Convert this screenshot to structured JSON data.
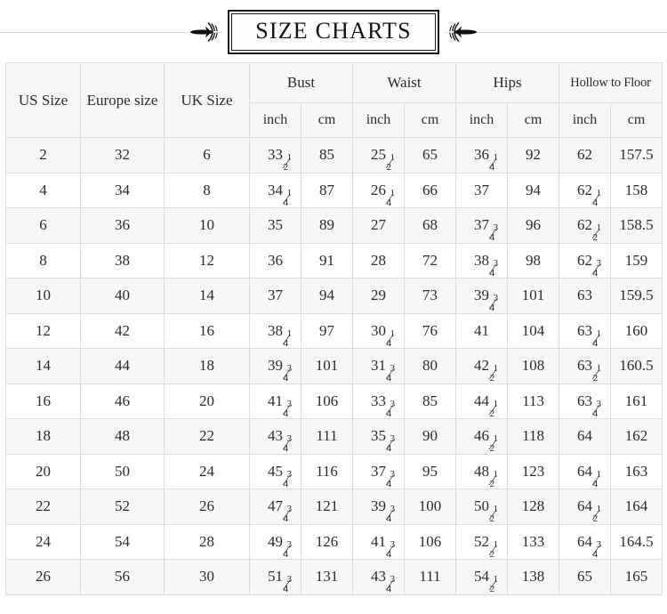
{
  "banner": {
    "title": "SIZE CHARTS",
    "left_ornament": "leaf-fleuron-icon",
    "right_ornament": "leaf-fleuron-icon"
  },
  "colors": {
    "header_bg": "#f7f7f7",
    "row_shade_bg": "#f7f7f7",
    "row_plain_bg": "#ffffff",
    "border": "#dcdcdc",
    "text": "#2b2b2b",
    "title_border": "#1a1a1a",
    "rule": "#d9d9d9"
  },
  "table": {
    "group_headers": [
      {
        "label": "US Size",
        "span": 1,
        "rowspan": 2
      },
      {
        "label": "Europe size",
        "span": 1,
        "rowspan": 2
      },
      {
        "label": "UK Size",
        "span": 1,
        "rowspan": 2
      },
      {
        "label": "Bust",
        "span": 2,
        "rowspan": 1
      },
      {
        "label": "Waist",
        "span": 2,
        "rowspan": 1
      },
      {
        "label": "Hips",
        "span": 2,
        "rowspan": 1
      },
      {
        "label": "Hollow to Floor",
        "span": 2,
        "rowspan": 1
      }
    ],
    "unit_headers": [
      "inch",
      "cm",
      "inch",
      "cm",
      "inch",
      "cm",
      "inch",
      "cm"
    ],
    "columns": [
      "US Size",
      "Europe size",
      "UK Size",
      "Bust inch",
      "Bust cm",
      "Waist inch",
      "Waist cm",
      "Hips inch",
      "Hips cm",
      "Hollow to Floor inch",
      "Hollow to Floor cm"
    ],
    "rows": [
      {
        "us": "2",
        "eu": "32",
        "uk": "6",
        "bust_in": "33 1/2",
        "bust_cm": "85",
        "waist_in": "25 1/2",
        "waist_cm": "65",
        "hips_in": "36 1/4",
        "hips_cm": "92",
        "hollow_in": "62",
        "hollow_cm": "157.5"
      },
      {
        "us": "4",
        "eu": "34",
        "uk": "8",
        "bust_in": "34 1/4",
        "bust_cm": "87",
        "waist_in": "26 1/4",
        "waist_cm": "66",
        "hips_in": "37",
        "hips_cm": "94",
        "hollow_in": "62 1/4",
        "hollow_cm": "158"
      },
      {
        "us": "6",
        "eu": "36",
        "uk": "10",
        "bust_in": "35",
        "bust_cm": "89",
        "waist_in": "27",
        "waist_cm": "68",
        "hips_in": "37 3/4",
        "hips_cm": "96",
        "hollow_in": "62 1/2",
        "hollow_cm": "158.5"
      },
      {
        "us": "8",
        "eu": "38",
        "uk": "12",
        "bust_in": "36",
        "bust_cm": "91",
        "waist_in": "28",
        "waist_cm": "72",
        "hips_in": "38 3/4",
        "hips_cm": "98",
        "hollow_in": "62 3/4",
        "hollow_cm": "159"
      },
      {
        "us": "10",
        "eu": "40",
        "uk": "14",
        "bust_in": "37",
        "bust_cm": "94",
        "waist_in": "29",
        "waist_cm": "73",
        "hips_in": "39 3/4",
        "hips_cm": "101",
        "hollow_in": "63",
        "hollow_cm": "159.5"
      },
      {
        "us": "12",
        "eu": "42",
        "uk": "16",
        "bust_in": "38 1/4",
        "bust_cm": "97",
        "waist_in": "30 1/4",
        "waist_cm": "76",
        "hips_in": "41",
        "hips_cm": "104",
        "hollow_in": "63 1/4",
        "hollow_cm": "160"
      },
      {
        "us": "14",
        "eu": "44",
        "uk": "18",
        "bust_in": "39 3/4",
        "bust_cm": "101",
        "waist_in": "31 3/4",
        "waist_cm": "80",
        "hips_in": "42 1/2",
        "hips_cm": "108",
        "hollow_in": "63 1/2",
        "hollow_cm": "160.5"
      },
      {
        "us": "16",
        "eu": "46",
        "uk": "20",
        "bust_in": "41 3/4",
        "bust_cm": "106",
        "waist_in": "33 3/4",
        "waist_cm": "85",
        "hips_in": "44 1/2",
        "hips_cm": "113",
        "hollow_in": "63 3/4",
        "hollow_cm": "161"
      },
      {
        "us": "18",
        "eu": "48",
        "uk": "22",
        "bust_in": "43 3/4",
        "bust_cm": "111",
        "waist_in": "35 3/4",
        "waist_cm": "90",
        "hips_in": "46 1/2",
        "hips_cm": "118",
        "hollow_in": "64",
        "hollow_cm": "162"
      },
      {
        "us": "20",
        "eu": "50",
        "uk": "24",
        "bust_in": "45 3/4",
        "bust_cm": "116",
        "waist_in": "37 3/4",
        "waist_cm": "95",
        "hips_in": "48 1/2",
        "hips_cm": "123",
        "hollow_in": "64 1/4",
        "hollow_cm": "163"
      },
      {
        "us": "22",
        "eu": "52",
        "uk": "26",
        "bust_in": "47 3/4",
        "bust_cm": "121",
        "waist_in": "39 3/4",
        "waist_cm": "100",
        "hips_in": "50 1/2",
        "hips_cm": "128",
        "hollow_in": "64 1/2",
        "hollow_cm": "164"
      },
      {
        "us": "24",
        "eu": "54",
        "uk": "28",
        "bust_in": "49 3/4",
        "bust_cm": "126",
        "waist_in": "41 3/4",
        "waist_cm": "106",
        "hips_in": "52 1/2",
        "hips_cm": "133",
        "hollow_in": "64 3/4",
        "hollow_cm": "164.5"
      },
      {
        "us": "26",
        "eu": "56",
        "uk": "30",
        "bust_in": "51 3/4",
        "bust_cm": "131",
        "waist_in": "43 3/4",
        "waist_cm": "111",
        "hips_in": "54 1/2",
        "hips_cm": "138",
        "hollow_in": "65",
        "hollow_cm": "165"
      }
    ]
  }
}
